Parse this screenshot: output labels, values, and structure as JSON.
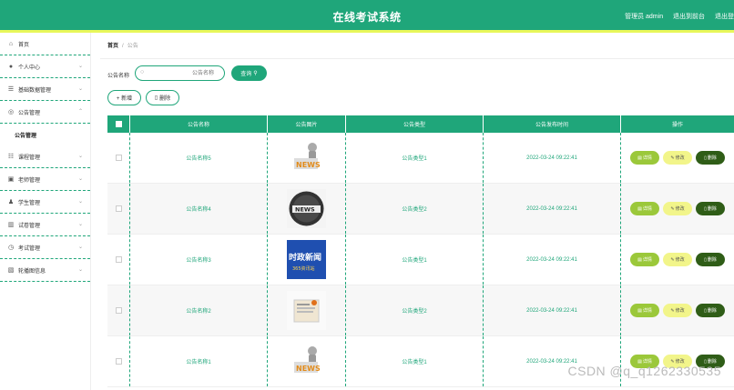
{
  "header": {
    "title": "在线考试系统",
    "admin_label": "管理员 admin",
    "backend_link": "退出到前台",
    "logout_link": "退出登"
  },
  "sidebar": {
    "items": [
      {
        "label": "首页",
        "icon": "home-icon"
      },
      {
        "label": "个人中心",
        "icon": "user-icon"
      },
      {
        "label": "基础数据管理",
        "icon": "list-icon"
      },
      {
        "label": "公告管理",
        "icon": "notice-icon"
      },
      {
        "label": "公告管理",
        "icon": ""
      },
      {
        "label": "课程管理",
        "icon": "course-icon"
      },
      {
        "label": "老师管理",
        "icon": "teacher-icon"
      },
      {
        "label": "学生管理",
        "icon": "student-icon"
      },
      {
        "label": "试卷管理",
        "icon": "chart-icon"
      },
      {
        "label": "考试管理",
        "icon": "exam-icon"
      },
      {
        "label": "轮播图信息",
        "icon": "image-icon"
      }
    ]
  },
  "breadcrumb": {
    "home": "首页",
    "sep": "/",
    "current": "公告"
  },
  "search": {
    "label": "公告名称",
    "placeholder": "公告名称",
    "query_label": "查询"
  },
  "actions": {
    "add_label": "+ 新增",
    "delete_label": "删除"
  },
  "table": {
    "headers": [
      "公告名称",
      "公告图片",
      "公告类型",
      "公告发布时间",
      "操作"
    ],
    "rows": [
      {
        "name": "公告名称5",
        "type": "公告类型1",
        "time": "2022-03-24 09:22:41",
        "image": "news-figure"
      },
      {
        "name": "公告名称4",
        "type": "公告类型2",
        "time": "2022-03-24 09:22:41",
        "image": "news-globe"
      },
      {
        "name": "公告名称3",
        "type": "公告类型1",
        "time": "2022-03-24 09:22:41",
        "image": "news-text",
        "image_text": "时政新闻",
        "image_subtext": "365资讯站"
      },
      {
        "name": "公告名称2",
        "type": "公告类型2",
        "time": "2022-03-24 09:22:41",
        "image": "news-paper"
      },
      {
        "name": "公告名称1",
        "type": "公告类型1",
        "time": "2022-03-24 09:22:41",
        "image": "news-figure"
      }
    ],
    "row_actions": {
      "detail": "详情",
      "edit": "修改",
      "delete": "删除"
    }
  },
  "watermark": "CSDN @q_q1262330535",
  "colors": {
    "primary": "#1fa67a",
    "accent_stripe": "#e8f75a",
    "detail": "#9bc83a",
    "edit": "#f2f58a",
    "delete": "#2f5d17"
  }
}
